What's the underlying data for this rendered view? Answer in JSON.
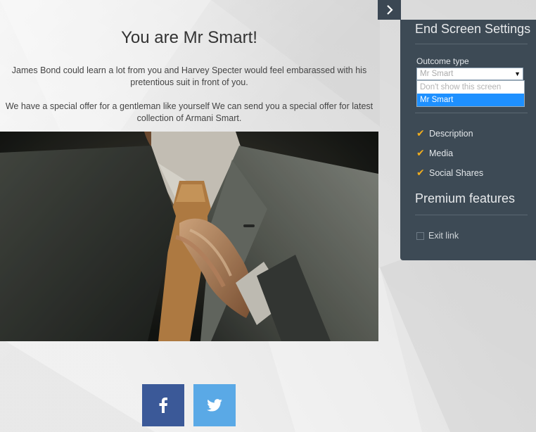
{
  "main": {
    "title": "You are Mr Smart!",
    "paragraph1": "James Bond could learn a lot from you and Harvey Specter would feel embarassed with his pretentious suit in front of you.",
    "paragraph2": "We have a special offer for a gentleman like yourself We can send you a special offer for latest collection of Armani Smart.",
    "image_icon": "man-adjusting-tie-photo",
    "share_buttons": [
      {
        "network": "facebook",
        "icon": "facebook-icon",
        "color": "#3b5998"
      },
      {
        "network": "twitter",
        "icon": "twitter-icon",
        "color": "#5aa9e6"
      }
    ]
  },
  "panel": {
    "toggle_icon": "chevron-right-icon",
    "title": "End Screen Settings",
    "outcome_label": "Outcome type",
    "outcome_value": "Mr Smart",
    "outcome_options": [
      "Don't show this screen",
      "Mr Smart"
    ],
    "selected_option": "Mr Smart",
    "features": [
      "Description",
      "Media",
      "Social Shares"
    ],
    "premium_title": "Premium features",
    "exit_link_label": "Exit link",
    "accent_color": "#f0ad1e",
    "panel_color": "#3d4a55"
  }
}
